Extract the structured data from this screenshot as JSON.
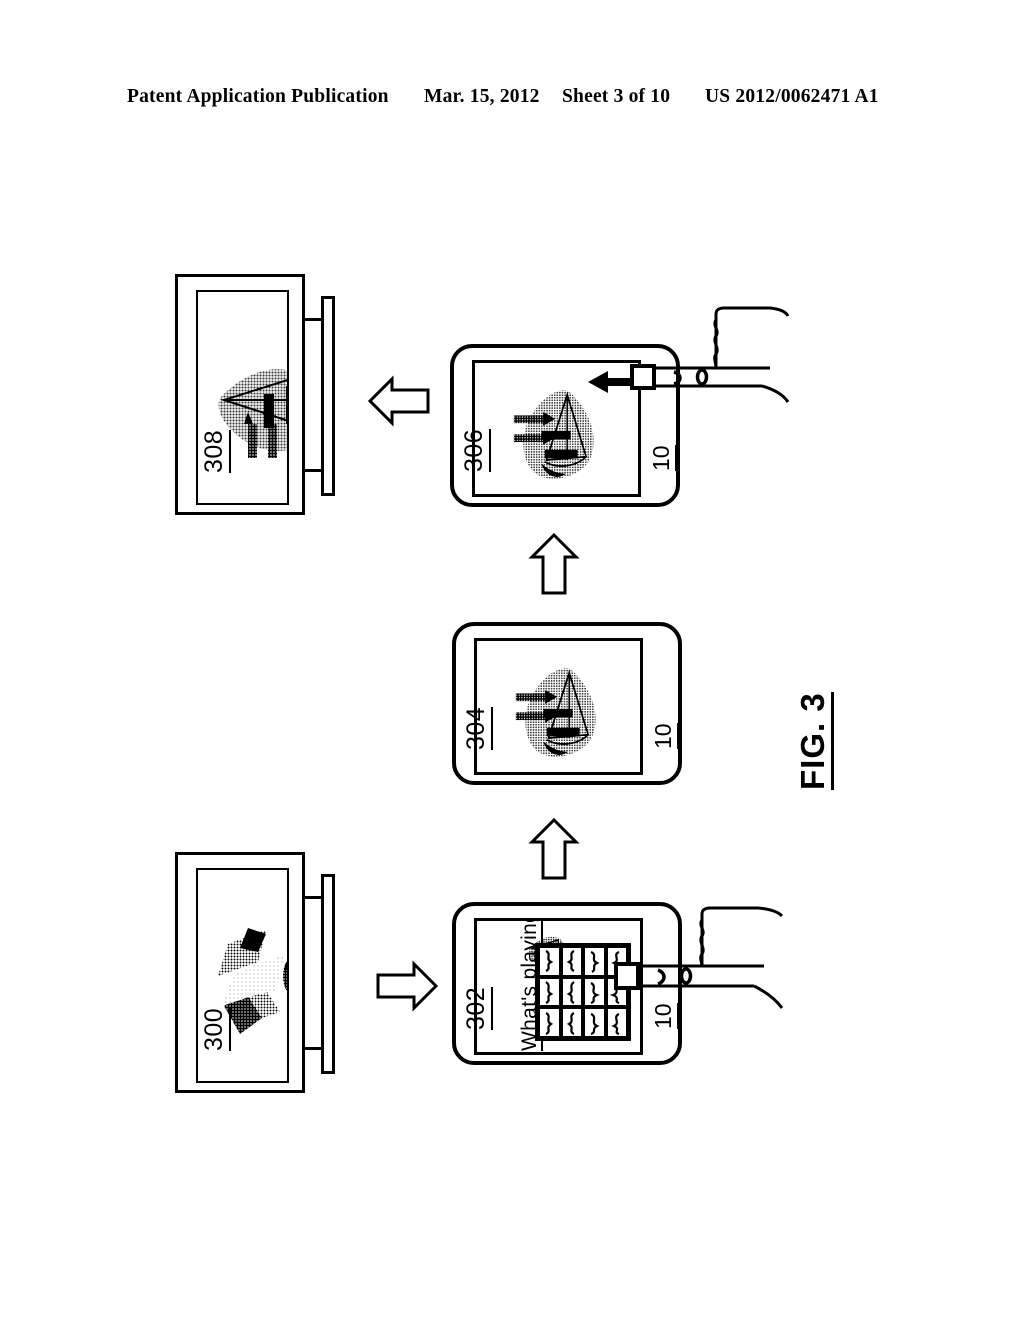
{
  "header": {
    "publication": "Patent Application Publication",
    "date": "Mar. 15, 2012",
    "sheet": "Sheet 3 of 10",
    "patent_number": "US 2012/0062471 A1"
  },
  "figure": {
    "label": "FIG. 3",
    "orientation": "landscape-rotated-90"
  },
  "devices": {
    "tv_bottom": {
      "ref": "300",
      "kind": "television-display",
      "screen_content": "halftone-photo-shoes"
    },
    "tv_top": {
      "ref": "308",
      "kind": "television-display",
      "screen_content": "halftone-photo-sailboat"
    },
    "tablet_bottom": {
      "ref": "302",
      "device_num": "10",
      "kind": "tablet",
      "screen_title": "What's playing",
      "thumbnail": "halftone-photo-sailboat-small",
      "grid_cells": [
        "squiggle-1",
        "squiggle-2",
        "squiggle-3",
        "squiggle-4",
        "squiggle-5",
        "squiggle-6",
        "squiggle-7",
        "squiggle-8",
        "squiggle-9",
        "squiggle-10",
        "squiggle-11",
        "squiggle-12"
      ],
      "touch": "finger-tap"
    },
    "tablet_middle": {
      "ref": "304",
      "device_num": "10",
      "kind": "tablet",
      "screen_content": "halftone-photo-sailboat"
    },
    "tablet_top": {
      "ref": "306",
      "device_num": "10",
      "kind": "tablet",
      "screen_content": "halftone-photo-sailboat",
      "touch": "finger-swipe",
      "gesture_arrow": "arrow-left"
    }
  },
  "flow_arrows": [
    {
      "name": "arrow-right-bottom",
      "direction": "right",
      "from": "tablet_302",
      "to": "tv_300"
    },
    {
      "name": "arrow-up-lower",
      "direction": "up",
      "from": "tablet_302",
      "to": "tablet_304"
    },
    {
      "name": "arrow-up-upper",
      "direction": "up",
      "from": "tablet_304",
      "to": "tablet_306"
    },
    {
      "name": "arrow-left-top",
      "direction": "left",
      "from": "tablet_306",
      "to": "tv_308"
    }
  ]
}
